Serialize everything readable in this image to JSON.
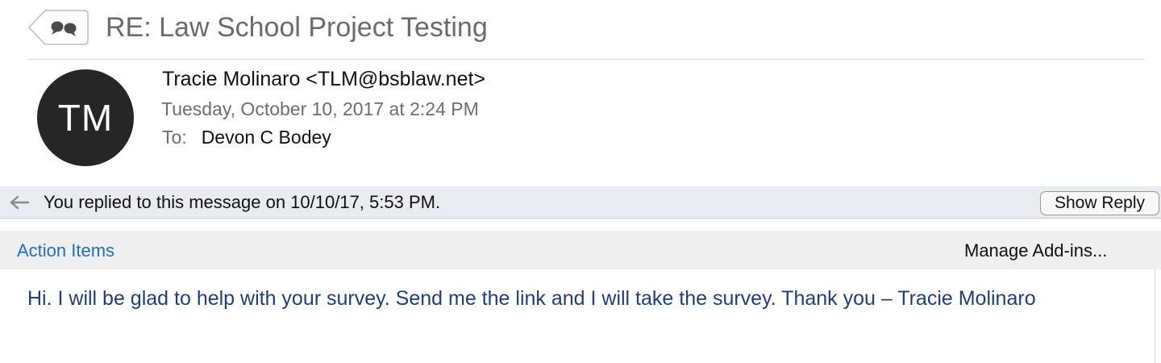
{
  "subject": "RE: Law School Project Testing",
  "thread_icon": "speech-bubbles-icon",
  "sender": {
    "initials": "TM",
    "display": "Tracie Molinaro <TLM@bsblaw.net>",
    "date": "Tuesday, October 10, 2017 at 2:24 PM",
    "to_label": "To:",
    "to_value": "Devon C Bodey"
  },
  "replied_banner": {
    "icon": "reply-arrow-icon",
    "text": "You replied to this message on 10/10/17, 5:53 PM.",
    "button_label": "Show Reply"
  },
  "addins_bar": {
    "action_items_label": "Action Items",
    "manage_label": "Manage Add-ins..."
  },
  "body": {
    "text": "Hi.  I will be glad to help with your survey.  Send me the link and I will take the survey.  Thank you – Tracie Molinaro"
  },
  "colors": {
    "avatar_bg": "#262626",
    "link_blue": "#1f6fbf",
    "body_text": "#1f3f7a",
    "banner_bg": "#e8ebef"
  }
}
